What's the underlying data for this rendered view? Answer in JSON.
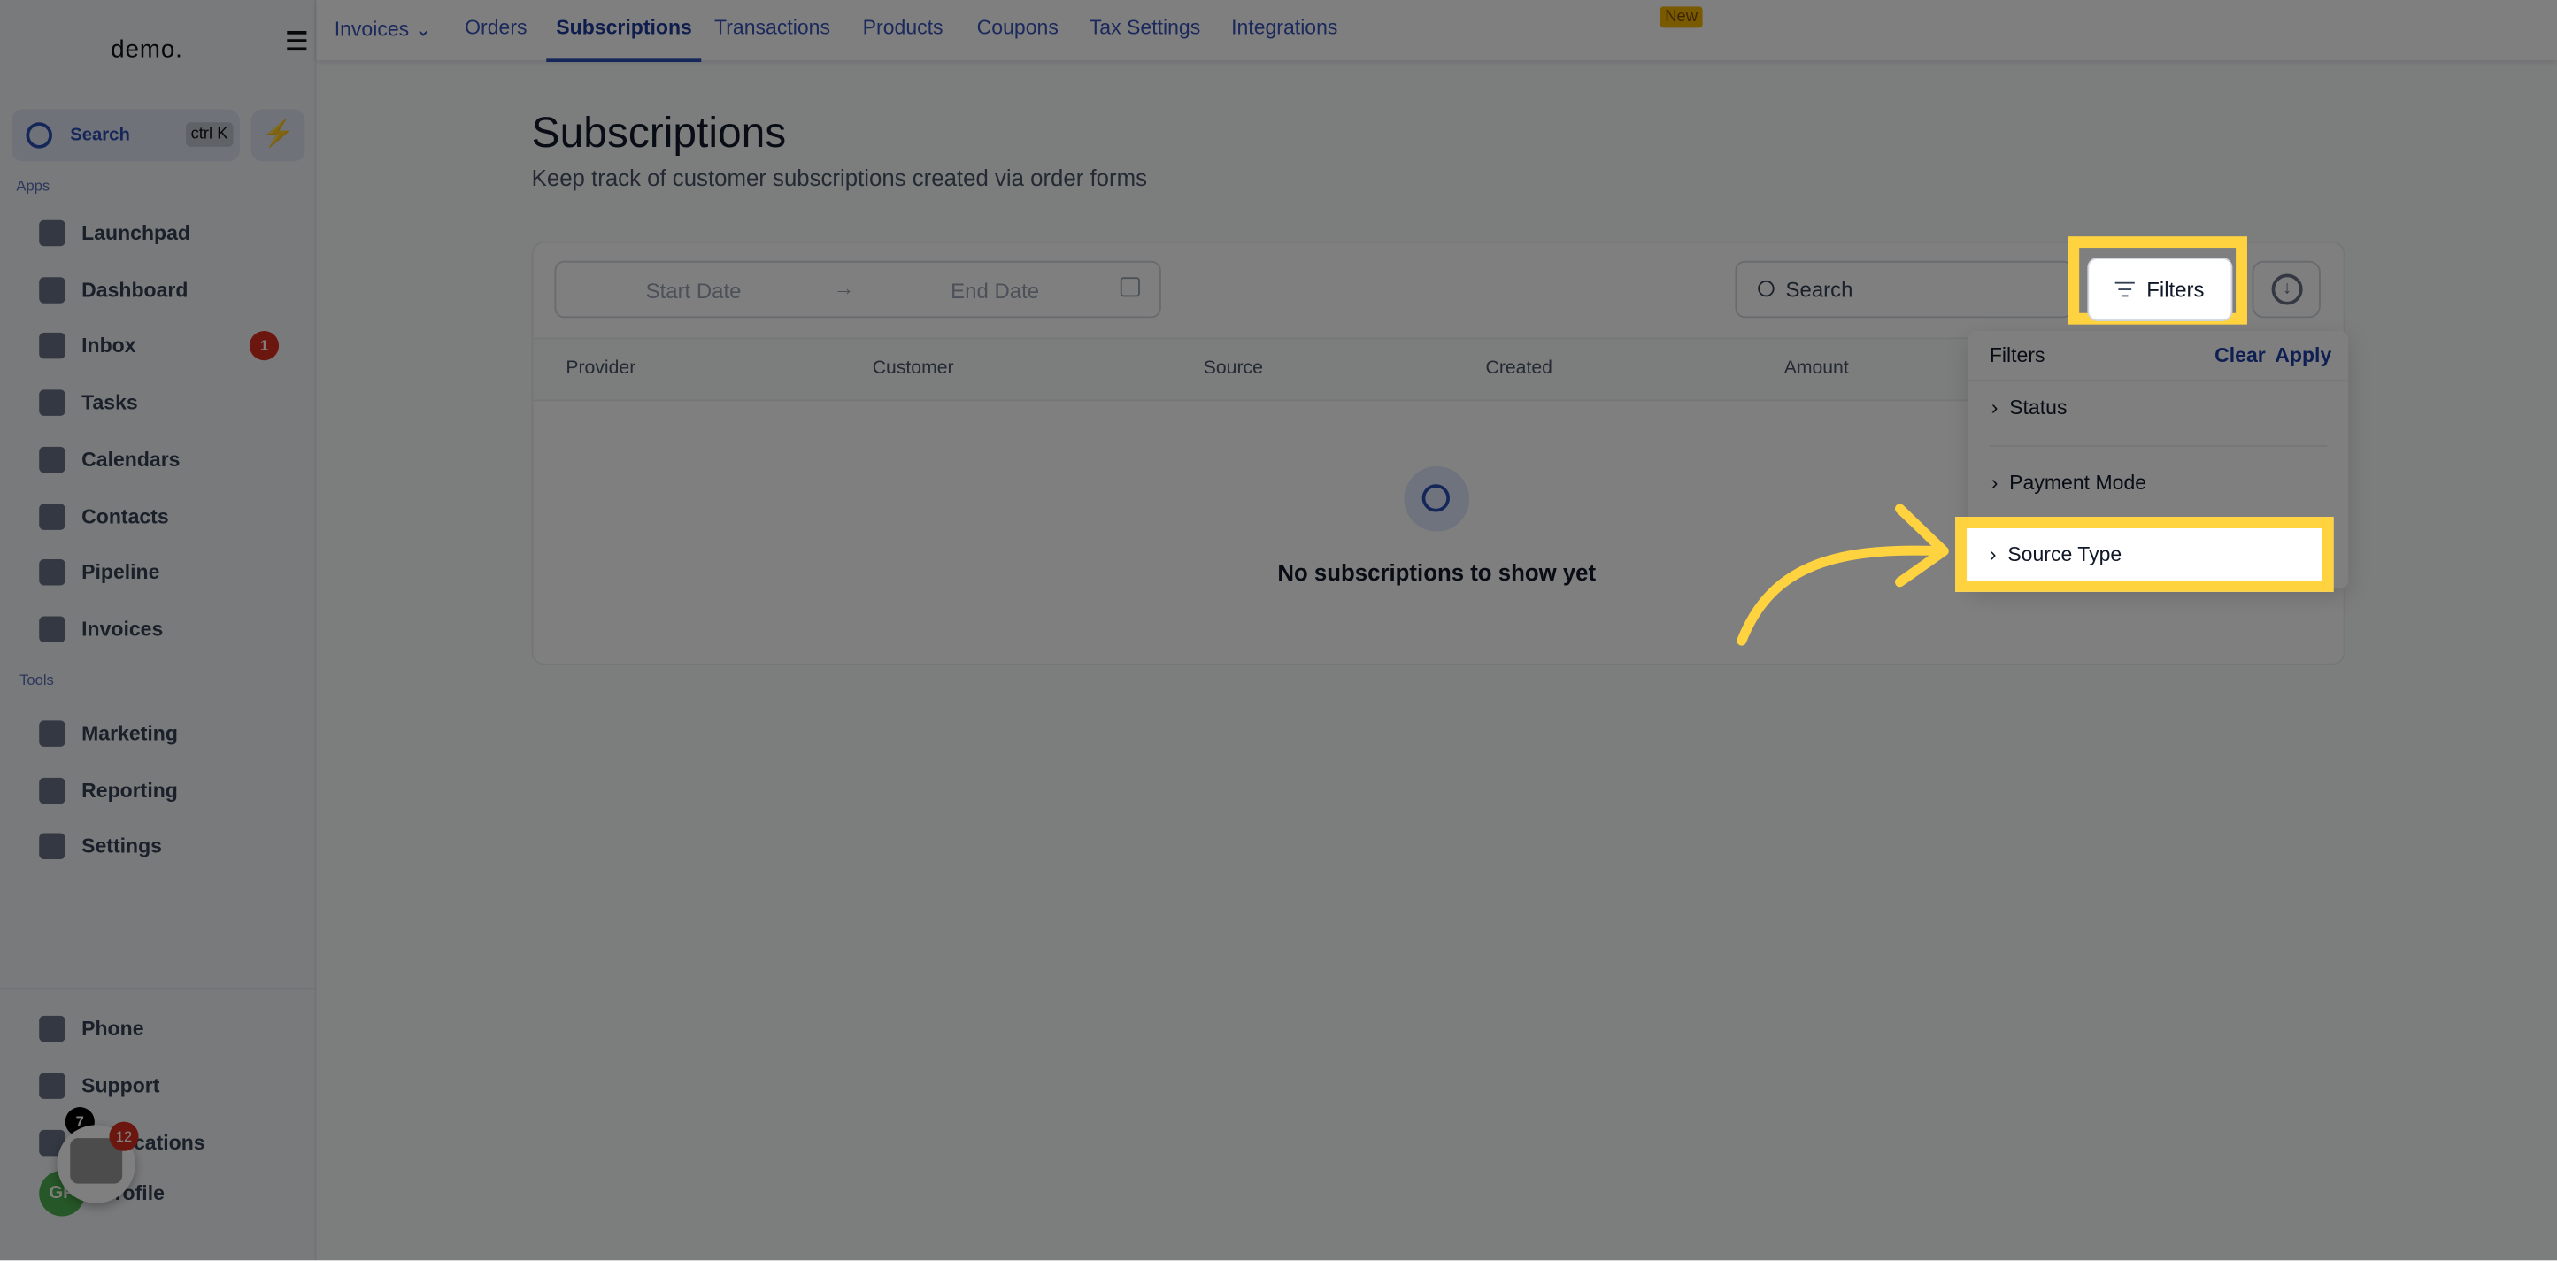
{
  "app": {
    "logo": "demo.",
    "colors": {
      "accent": "#2b4db3",
      "highlight": "#ffd23f",
      "badge": "#d92d20"
    }
  },
  "sidebar": {
    "search_label": "Search",
    "search_shortcut": "ctrl K",
    "apps_label": "Apps",
    "tools_label": "Tools",
    "apps": [
      {
        "label": "Launchpad",
        "icon": "rocket-icon"
      },
      {
        "label": "Dashboard",
        "icon": "grid-icon"
      },
      {
        "label": "Inbox",
        "icon": "inbox-icon",
        "badge": "1"
      },
      {
        "label": "Tasks",
        "icon": "clipboard-icon"
      },
      {
        "label": "Calendars",
        "icon": "calendar-icon"
      },
      {
        "label": "Contacts",
        "icon": "user-icon"
      },
      {
        "label": "Pipeline",
        "icon": "funnel-icon"
      },
      {
        "label": "Invoices",
        "icon": "invoice-icon"
      }
    ],
    "tools": [
      {
        "label": "Marketing",
        "icon": "megaphone-icon"
      },
      {
        "label": "Reporting",
        "icon": "pie-chart-icon"
      },
      {
        "label": "Settings",
        "icon": "gear-icon"
      }
    ],
    "bottom": [
      {
        "label": "Phone",
        "icon": "phone-icon"
      },
      {
        "label": "Support",
        "icon": "chat-icon"
      },
      {
        "label": "Notifications",
        "icon": "bell-icon",
        "badge": "7"
      },
      {
        "label": "Profile",
        "avatar": "GP"
      }
    ],
    "chat_widget_badge": "12"
  },
  "topnav": {
    "tabs": [
      {
        "label": "Invoices"
      },
      {
        "label": "Orders"
      },
      {
        "label": "Subscriptions",
        "active": true
      },
      {
        "label": "Transactions"
      },
      {
        "label": "Products"
      },
      {
        "label": "Coupons"
      },
      {
        "label": "Tax Settings"
      },
      {
        "label": "Integrations"
      }
    ],
    "new_badge": "New"
  },
  "page": {
    "title": "Subscriptions",
    "subtitle": "Keep track of customer subscriptions created via order forms"
  },
  "toolbar": {
    "start_date": "Start Date",
    "end_date": "End Date",
    "search_placeholder": "Search",
    "filters_label": "Filters"
  },
  "table": {
    "columns": [
      "Provider",
      "Customer",
      "Source",
      "Created",
      "Amount"
    ],
    "empty_text": "No subscriptions to show yet"
  },
  "filters": {
    "title": "Filters",
    "clear": "Clear",
    "apply": "Apply",
    "items": [
      "Status",
      "Payment Mode",
      "Source Type"
    ]
  }
}
